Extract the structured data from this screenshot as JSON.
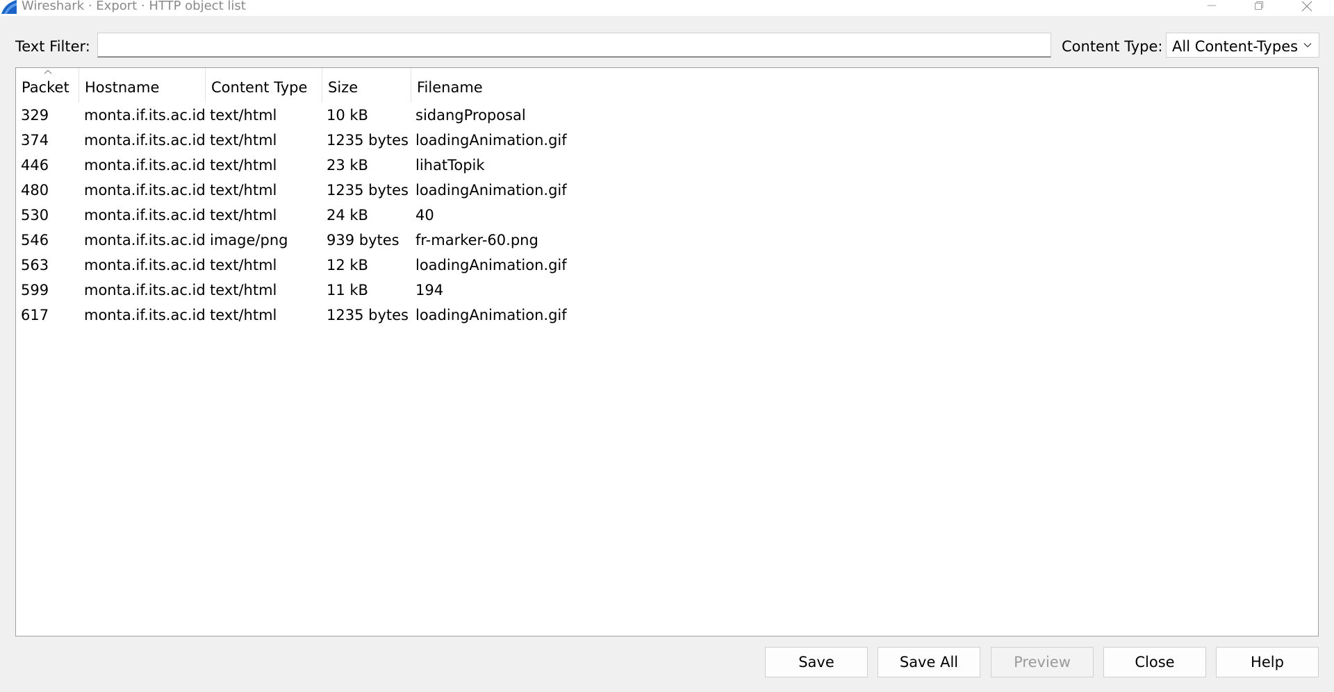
{
  "window": {
    "title": "Wireshark · Export · HTTP object list"
  },
  "filter": {
    "label": "Text Filter:",
    "value": "",
    "placeholder": ""
  },
  "content_type": {
    "label": "Content Type:",
    "selected": "All Content-Types"
  },
  "table": {
    "columns": [
      "Packet",
      "Hostname",
      "Content Type",
      "Size",
      "Filename"
    ],
    "sort_column": "Packet",
    "sort_direction": "ascending",
    "rows": [
      [
        "329",
        "monta.if.its.ac.id",
        "text/html",
        "10 kB",
        "sidangProposal"
      ],
      [
        "374",
        "monta.if.its.ac.id",
        "text/html",
        "1235 bytes",
        "loadingAnimation.gif"
      ],
      [
        "446",
        "monta.if.its.ac.id",
        "text/html",
        "23 kB",
        "lihatTopik"
      ],
      [
        "480",
        "monta.if.its.ac.id",
        "text/html",
        "1235 bytes",
        "loadingAnimation.gif"
      ],
      [
        "530",
        "monta.if.its.ac.id",
        "text/html",
        "24 kB",
        "40"
      ],
      [
        "546",
        "monta.if.its.ac.id",
        "image/png",
        "939 bytes",
        "fr-marker-60.png"
      ],
      [
        "563",
        "monta.if.its.ac.id",
        "text/html",
        "12 kB",
        "loadingAnimation.gif"
      ],
      [
        "599",
        "monta.if.its.ac.id",
        "text/html",
        "11 kB",
        "194"
      ],
      [
        "617",
        "monta.if.its.ac.id",
        "text/html",
        "1235 bytes",
        "loadingAnimation.gif"
      ]
    ]
  },
  "buttons": {
    "save": "Save",
    "save_all": "Save All",
    "preview": "Preview",
    "close": "Close",
    "help": "Help"
  },
  "colors": {
    "dialog_background": "#f0f0f0",
    "disabled_text": "#9a9a9a",
    "wireshark_fin": "#1a63c7"
  },
  "icons": {
    "app": "wireshark-fin-icon",
    "minimize": "minimize-icon",
    "maximize": "restore-icon",
    "close": "close-icon",
    "dropdown": "chevron-down-icon",
    "sort": "sort-ascending-icon"
  }
}
